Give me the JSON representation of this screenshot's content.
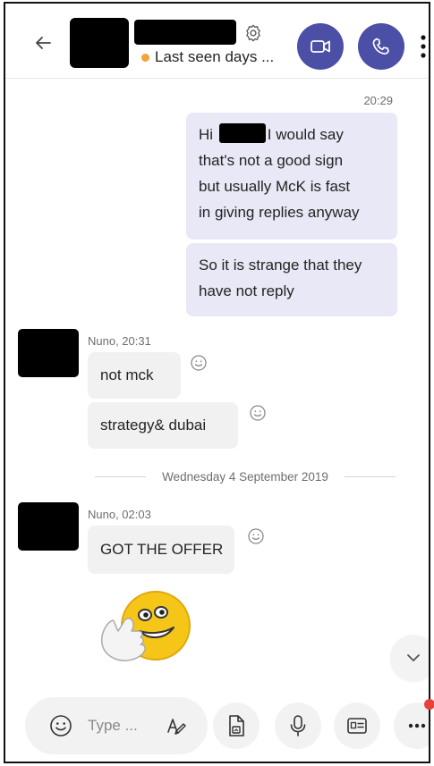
{
  "header": {
    "status_text": "Last seen days ...",
    "status_color": "#f2a33a",
    "accent_color": "#4b4fa6",
    "icons": [
      "back-arrow-icon",
      "settings-icon",
      "video-call-icon",
      "phone-call-icon",
      "more-vertical-icon"
    ]
  },
  "messages": {
    "outgoing_time": "20:29",
    "out_1_greeting": "Hi",
    "out_1_line1": "I would say",
    "out_1_line2": "that's not a good sign",
    "out_1_line3": "but usually McK is fast",
    "out_1_line4": "in giving replies anyway",
    "out_2_line1": "So it is strange that they",
    "out_2_line2": "have not reply",
    "group1_sender": "Nuno, 20:31",
    "group1_msg1": "not mck",
    "group1_msg2": "strategy& dubai",
    "date_divider": "Wednesday 4 September 2019",
    "group2_sender": "Nuno, 02:03",
    "group2_msg1": "GOT THE OFFER"
  },
  "composer": {
    "placeholder": "Type ...",
    "icons": [
      "emoji-icon",
      "format-icon",
      "attach-file-icon",
      "microphone-icon",
      "contact-card-icon",
      "more-horizontal-icon",
      "chevron-down-icon"
    ]
  }
}
